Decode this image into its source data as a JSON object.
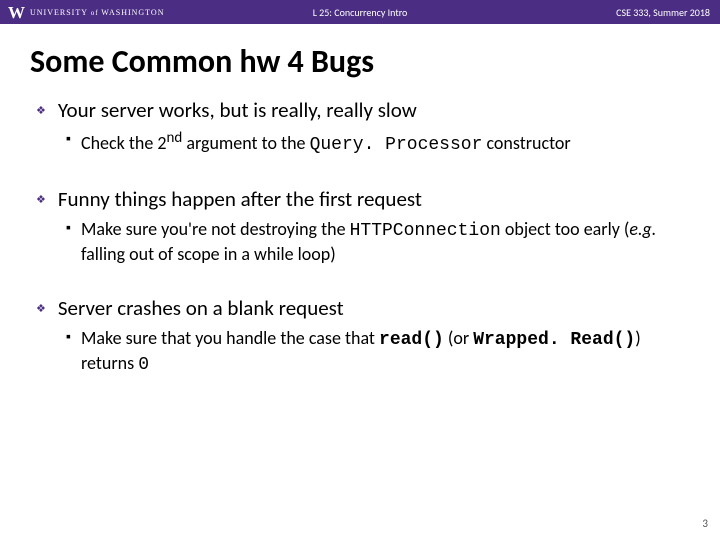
{
  "header": {
    "uw_mark": "W",
    "uw_name_pre": "UNIVERSITY ",
    "uw_name_of": "of ",
    "uw_name_post": "WASHINGTON",
    "center": "L 25: Concurrency Intro",
    "right": "CSE 333, Summer 2018"
  },
  "title": "Some Common hw 4 Bugs",
  "bugs": [
    {
      "point": "Your server works, but is really, really slow",
      "subs": [
        {
          "pre": "Check the 2",
          "sup": "nd",
          "mid": " argument to the ",
          "code": "Query. Processor",
          "post": " constructor"
        }
      ]
    },
    {
      "point": "Funny things happen after the first request",
      "subs": [
        {
          "pre": "Make sure you're not destroying the ",
          "code": "HTTPConnection",
          "mid": " object too early (",
          "ital": "e.g.",
          "post": " falling out of scope in a while loop)"
        }
      ]
    },
    {
      "point": "Server crashes on a blank request",
      "subs": [
        {
          "pre": "Make sure that you handle the case that ",
          "codeb1": "read()",
          "mid": " (or ",
          "codeb2": "Wrapped. Read()",
          "post1": ") returns ",
          "post2": "0"
        }
      ]
    }
  ],
  "page": "3"
}
